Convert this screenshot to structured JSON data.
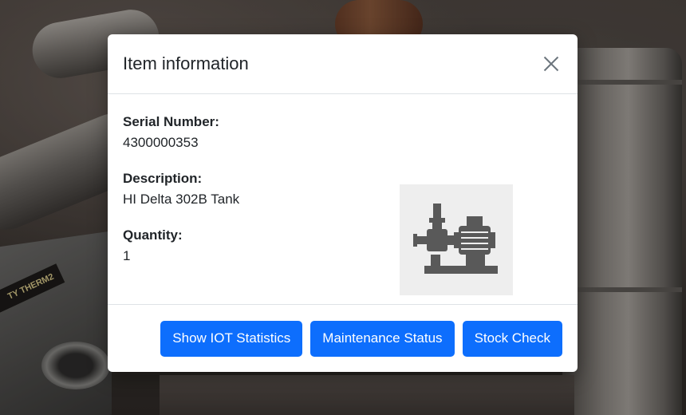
{
  "modal": {
    "title": "Item information",
    "fields": [
      {
        "label": "Serial Number:",
        "value": "4300000353"
      },
      {
        "label": "Description:",
        "value": "HI Delta 302B Tank"
      },
      {
        "label": "Quantity:",
        "value": "1"
      }
    ],
    "image_icon": "pump-motor-icon",
    "buttons": {
      "iot_stats": "Show IOT Statistics",
      "maintenance": "Maintenance Status",
      "stock_check": "Stock Check"
    }
  },
  "background": {
    "label_text": "TY THERM2"
  },
  "colors": {
    "primary": "#0d6efd",
    "icon_fill": "#595959",
    "image_bg": "#eeeeee"
  }
}
